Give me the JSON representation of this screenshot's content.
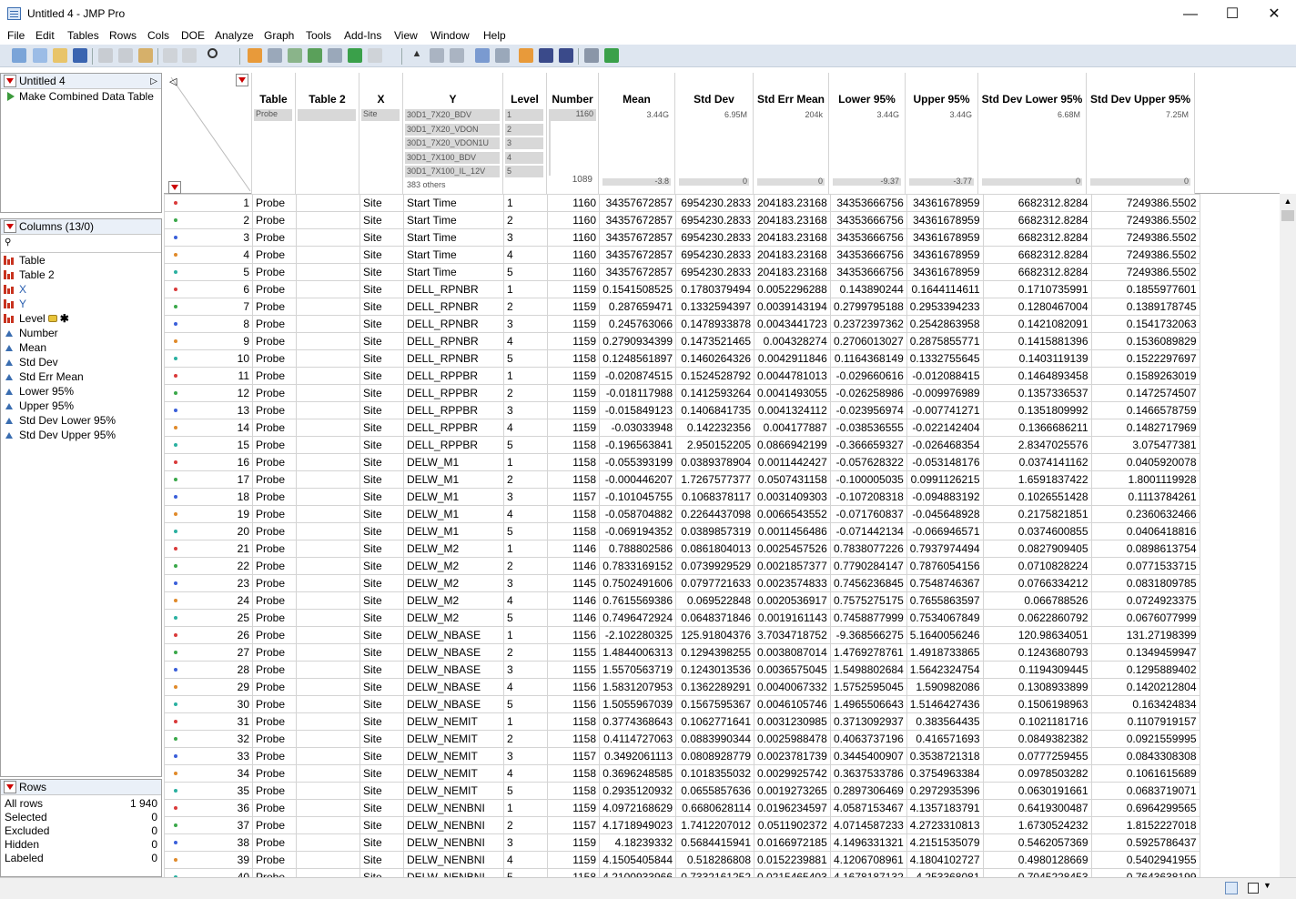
{
  "window": {
    "title": "Untitled 4 - JMP Pro"
  },
  "menu": [
    "File",
    "Edit",
    "Tables",
    "Rows",
    "Cols",
    "DOE",
    "Analyze",
    "Graph",
    "Tools",
    "Add-Ins",
    "View",
    "Window",
    "Help"
  ],
  "table_panel": {
    "name": "Untitled 4",
    "script": "Make Combined Data Table"
  },
  "columns_panel": {
    "title": "Columns (13/0)",
    "columns": [
      "Table",
      "Table 2",
      "X",
      "Y",
      "Level",
      "Number",
      "Mean",
      "Std Dev",
      "Std Err Mean",
      "Lower 95%",
      "Upper 95%",
      "Std Dev Lower 95%",
      "Std Dev Upper 95%"
    ]
  },
  "rows_panel": {
    "title": "Rows",
    "items": [
      {
        "label": "All rows",
        "value": "1 940"
      },
      {
        "label": "Selected",
        "value": "0"
      },
      {
        "label": "Excluded",
        "value": "0"
      },
      {
        "label": "Hidden",
        "value": "0"
      },
      {
        "label": "Labeled",
        "value": "0"
      }
    ]
  },
  "header_columns": [
    "Table",
    "Table 2",
    "X",
    "Y",
    "Level",
    "Number",
    "Mean",
    "Std Dev",
    "Std Err Mean",
    "Lower 95%",
    "Upper 95%",
    "Std Dev Lower 95%",
    "Std Dev Upper 95%"
  ],
  "summary": {
    "table": "Probe",
    "x": "Site",
    "y_values": [
      "30D1_7X20_BDV",
      "30D1_7X20_VDON",
      "30D1_7X20_VDON1U",
      "30D1_7X100_BDV",
      "30D1_7X100_IL_12V"
    ],
    "y_others": "383 others",
    "levels": [
      "1",
      "2",
      "3",
      "4",
      "5"
    ],
    "number_max": "1160",
    "number_min": "1089",
    "mean_max": "3.44G",
    "mean_min": "-3.8",
    "std_max": "6.95M",
    "std_min": "0",
    "sem_max": "204k",
    "sem_min": "0",
    "low_max": "3.44G",
    "low_min": "-9.37",
    "up_max": "3.44G",
    "up_min": "-3.77",
    "sdl_max": "6.68M",
    "sdl_min": "0",
    "sdu_max": "7.25M",
    "sdu_min": "0"
  },
  "rows": [
    [
      "1",
      "Probe",
      "",
      "Site",
      "Start Time",
      "1",
      "1160",
      "34357672857",
      "6954230.2833",
      "204183.23168",
      "34353666756",
      "34361678959",
      "6682312.8284",
      "7249386.5502"
    ],
    [
      "2",
      "Probe",
      "",
      "Site",
      "Start Time",
      "2",
      "1160",
      "34357672857",
      "6954230.2833",
      "204183.23168",
      "34353666756",
      "34361678959",
      "6682312.8284",
      "7249386.5502"
    ],
    [
      "3",
      "Probe",
      "",
      "Site",
      "Start Time",
      "3",
      "1160",
      "34357672857",
      "6954230.2833",
      "204183.23168",
      "34353666756",
      "34361678959",
      "6682312.8284",
      "7249386.5502"
    ],
    [
      "4",
      "Probe",
      "",
      "Site",
      "Start Time",
      "4",
      "1160",
      "34357672857",
      "6954230.2833",
      "204183.23168",
      "34353666756",
      "34361678959",
      "6682312.8284",
      "7249386.5502"
    ],
    [
      "5",
      "Probe",
      "",
      "Site",
      "Start Time",
      "5",
      "1160",
      "34357672857",
      "6954230.2833",
      "204183.23168",
      "34353666756",
      "34361678959",
      "6682312.8284",
      "7249386.5502"
    ],
    [
      "6",
      "Probe",
      "",
      "Site",
      "DELL_RPNBR",
      "1",
      "1159",
      "0.1541508525",
      "0.1780379494",
      "0.0052296288",
      "0.143890244",
      "0.1644114611",
      "0.1710735991",
      "0.1855977601"
    ],
    [
      "7",
      "Probe",
      "",
      "Site",
      "DELL_RPNBR",
      "2",
      "1159",
      "0.287659471",
      "0.1332594397",
      "0.0039143194",
      "0.2799795188",
      "0.2953394233",
      "0.1280467004",
      "0.1389178745"
    ],
    [
      "8",
      "Probe",
      "",
      "Site",
      "DELL_RPNBR",
      "3",
      "1159",
      "0.245763066",
      "0.1478933878",
      "0.0043441723",
      "0.2372397362",
      "0.2542863958",
      "0.1421082091",
      "0.1541732063"
    ],
    [
      "9",
      "Probe",
      "",
      "Site",
      "DELL_RPNBR",
      "4",
      "1159",
      "0.2790934399",
      "0.1473521465",
      "0.004328274",
      "0.2706013027",
      "0.2875855771",
      "0.1415881396",
      "0.1536089829"
    ],
    [
      "10",
      "Probe",
      "",
      "Site",
      "DELL_RPNBR",
      "5",
      "1158",
      "0.1248561897",
      "0.1460264326",
      "0.0042911846",
      "0.1164368149",
      "0.1332755645",
      "0.1403119139",
      "0.1522297697"
    ],
    [
      "11",
      "Probe",
      "",
      "Site",
      "DELL_RPPBR",
      "1",
      "1159",
      "-0.020874515",
      "0.1524528792",
      "0.0044781013",
      "-0.029660616",
      "-0.012088415",
      "0.1464893458",
      "0.1589263019"
    ],
    [
      "12",
      "Probe",
      "",
      "Site",
      "DELL_RPPBR",
      "2",
      "1159",
      "-0.018117988",
      "0.1412593264",
      "0.0041493055",
      "-0.026258986",
      "-0.009976989",
      "0.1357336537",
      "0.1472574507"
    ],
    [
      "13",
      "Probe",
      "",
      "Site",
      "DELL_RPPBR",
      "3",
      "1159",
      "-0.015849123",
      "0.1406841735",
      "0.0041324112",
      "-0.023956974",
      "-0.007741271",
      "0.1351809992",
      "0.1466578759"
    ],
    [
      "14",
      "Probe",
      "",
      "Site",
      "DELL_RPPBR",
      "4",
      "1159",
      "-0.03033948",
      "0.142232356",
      "0.004177887",
      "-0.038536555",
      "-0.022142404",
      "0.1366686211",
      "0.1482717969"
    ],
    [
      "15",
      "Probe",
      "",
      "Site",
      "DELL_RPPBR",
      "5",
      "1158",
      "-0.196563841",
      "2.950152205",
      "0.0866942199",
      "-0.366659327",
      "-0.026468354",
      "2.8347025576",
      "3.075477381"
    ],
    [
      "16",
      "Probe",
      "",
      "Site",
      "DELW_M1",
      "1",
      "1158",
      "-0.055393199",
      "0.0389378904",
      "0.0011442427",
      "-0.057628322",
      "-0.053148176",
      "0.0374141162",
      "0.0405920078"
    ],
    [
      "17",
      "Probe",
      "",
      "Site",
      "DELW_M1",
      "2",
      "1158",
      "-0.000446207",
      "1.7267577377",
      "0.0507431158",
      "-0.100005035",
      "0.0991126215",
      "1.6591837422",
      "1.8001119928"
    ],
    [
      "18",
      "Probe",
      "",
      "Site",
      "DELW_M1",
      "3",
      "1157",
      "-0.101045755",
      "0.1068378117",
      "0.0031409303",
      "-0.107208318",
      "-0.094883192",
      "0.1026551428",
      "0.1113784261"
    ],
    [
      "19",
      "Probe",
      "",
      "Site",
      "DELW_M1",
      "4",
      "1158",
      "-0.058704882",
      "0.2264437098",
      "0.0066543552",
      "-0.071760837",
      "-0.045648928",
      "0.2175821851",
      "0.2360632466"
    ],
    [
      "20",
      "Probe",
      "",
      "Site",
      "DELW_M1",
      "5",
      "1158",
      "-0.069194352",
      "0.0389857319",
      "0.0011456486",
      "-0.071442134",
      "-0.066946571",
      "0.0374600855",
      "0.0406418816"
    ],
    [
      "21",
      "Probe",
      "",
      "Site",
      "DELW_M2",
      "1",
      "1146",
      "0.788802586",
      "0.0861804013",
      "0.0025457526",
      "0.7838077226",
      "0.7937974494",
      "0.0827909405",
      "0.0898613754"
    ],
    [
      "22",
      "Probe",
      "",
      "Site",
      "DELW_M2",
      "2",
      "1146",
      "0.7833169152",
      "0.0739929529",
      "0.0021857377",
      "0.7790284147",
      "0.7876054156",
      "0.0710828224",
      "0.0771533715"
    ],
    [
      "23",
      "Probe",
      "",
      "Site",
      "DELW_M2",
      "3",
      "1145",
      "0.7502491606",
      "0.0797721633",
      "0.0023574833",
      "0.7456236845",
      "0.7548746367",
      "0.0766334212",
      "0.0831809785"
    ],
    [
      "24",
      "Probe",
      "",
      "Site",
      "DELW_M2",
      "4",
      "1146",
      "0.7615569386",
      "0.069522848",
      "0.0020536917",
      "0.7575275175",
      "0.7655863597",
      "0.066788526",
      "0.0724923375"
    ],
    [
      "25",
      "Probe",
      "",
      "Site",
      "DELW_M2",
      "5",
      "1146",
      "0.7496472924",
      "0.0648371846",
      "0.0019161143",
      "0.7458877999",
      "0.7534067849",
      "0.0622860792",
      "0.0676077999"
    ],
    [
      "26",
      "Probe",
      "",
      "Site",
      "DELW_NBASE",
      "1",
      "1156",
      "-2.102280325",
      "125.91804376",
      "3.7034718752",
      "-9.368566275",
      "5.1640056246",
      "120.98634051",
      "131.27198399"
    ],
    [
      "27",
      "Probe",
      "",
      "Site",
      "DELW_NBASE",
      "2",
      "1155",
      "1.4844006313",
      "0.1294398255",
      "0.0038087014",
      "1.4769278761",
      "1.4918733865",
      "0.1243680793",
      "0.1349459947"
    ],
    [
      "28",
      "Probe",
      "",
      "Site",
      "DELW_NBASE",
      "3",
      "1155",
      "1.5570563719",
      "0.1243013536",
      "0.0036575045",
      "1.5498802684",
      "1.5642324754",
      "0.1194309445",
      "0.1295889402"
    ],
    [
      "29",
      "Probe",
      "",
      "Site",
      "DELW_NBASE",
      "4",
      "1156",
      "1.5831207953",
      "0.1362289291",
      "0.0040067332",
      "1.5752595045",
      "1.590982086",
      "0.1308933899",
      "0.1420212804"
    ],
    [
      "30",
      "Probe",
      "",
      "Site",
      "DELW_NBASE",
      "5",
      "1156",
      "1.5055967039",
      "0.1567595367",
      "0.0046105746",
      "1.4965506643",
      "1.5146427436",
      "0.1506198963",
      "0.163424834"
    ],
    [
      "31",
      "Probe",
      "",
      "Site",
      "DELW_NEMIT",
      "1",
      "1158",
      "0.3774368643",
      "0.1062771641",
      "0.0031230985",
      "0.3713092937",
      "0.383564435",
      "0.1021181716",
      "0.1107919157"
    ],
    [
      "32",
      "Probe",
      "",
      "Site",
      "DELW_NEMIT",
      "2",
      "1158",
      "0.4114727063",
      "0.0883990344",
      "0.0025988478",
      "0.4063737196",
      "0.416571693",
      "0.0849382382",
      "0.0921559995"
    ],
    [
      "33",
      "Probe",
      "",
      "Site",
      "DELW_NEMIT",
      "3",
      "1157",
      "0.3492061113",
      "0.0808928779",
      "0.0023781739",
      "0.3445400907",
      "0.3538721318",
      "0.0777259455",
      "0.0843308308"
    ],
    [
      "34",
      "Probe",
      "",
      "Site",
      "DELW_NEMIT",
      "4",
      "1158",
      "0.3696248585",
      "0.1018355032",
      "0.0029925742",
      "0.3637533786",
      "0.3754963384",
      "0.0978503282",
      "0.1061615689"
    ],
    [
      "35",
      "Probe",
      "",
      "Site",
      "DELW_NEMIT",
      "5",
      "1158",
      "0.2935120932",
      "0.0655857636",
      "0.0019273265",
      "0.2897306469",
      "0.2972935396",
      "0.0630191661",
      "0.0683719071"
    ],
    [
      "36",
      "Probe",
      "",
      "Site",
      "DELW_NENBNI",
      "1",
      "1159",
      "4.0972168629",
      "0.6680628114",
      "0.0196234597",
      "4.0587153467",
      "4.1357183791",
      "0.6419300487",
      "0.6964299565"
    ],
    [
      "37",
      "Probe",
      "",
      "Site",
      "DELW_NENBNI",
      "2",
      "1157",
      "4.1718949023",
      "1.7412207012",
      "0.0511902372",
      "4.0714587233",
      "4.2723310813",
      "1.6730524232",
      "1.8152227018"
    ],
    [
      "38",
      "Probe",
      "",
      "Site",
      "DELW_NENBNI",
      "3",
      "1159",
      "4.18239332",
      "0.5684415941",
      "0.0166972185",
      "4.1496331321",
      "4.2151535079",
      "0.5462057369",
      "0.5925786437"
    ],
    [
      "39",
      "Probe",
      "",
      "Site",
      "DELW_NENBNI",
      "4",
      "1159",
      "4.1505405844",
      "0.518286808",
      "0.0152239881",
      "4.1206708961",
      "4.1804102727",
      "0.4980128669",
      "0.5402941955"
    ]
  ],
  "level_colors": [
    "#d93a3a",
    "#3aa84a",
    "#3a5fd9",
    "#e08a2a",
    "#2ab0a0"
  ]
}
